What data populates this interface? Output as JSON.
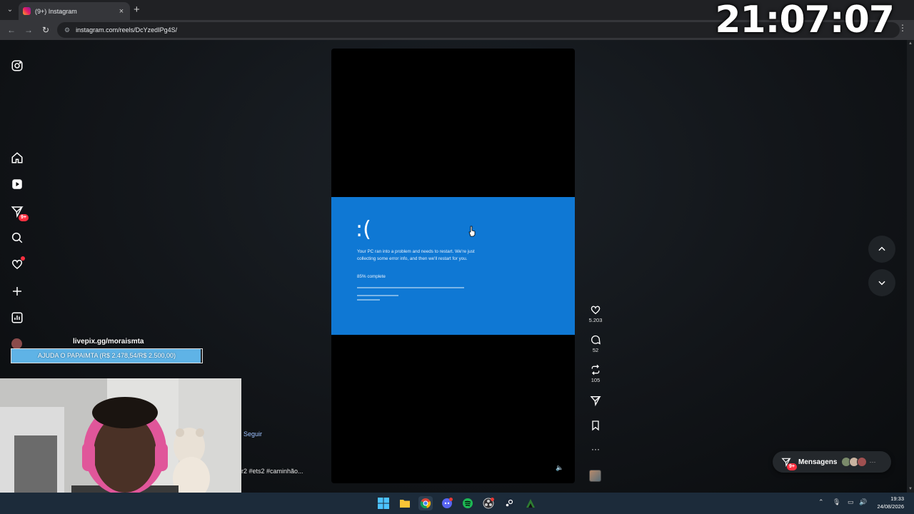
{
  "browser": {
    "tab_title": "(9+) Instagram",
    "url": "instagram.com/reels/DcYzedIPg4S/"
  },
  "overlay": {
    "clock": "21:07:07",
    "livepix_label": "livepix.gg/moraismta",
    "goal_text": "AJUDA O PAPAIMTA (R$ 2.478,54/R$ 2.500,00)",
    "goal_progress": 0.991
  },
  "sidebar": {
    "items": [
      {
        "name": "instagram-logo-icon"
      },
      {
        "name": "home-icon"
      },
      {
        "name": "reels-icon"
      },
      {
        "name": "messages-icon",
        "badge": "9+"
      },
      {
        "name": "search-icon"
      },
      {
        "name": "notifications-icon"
      },
      {
        "name": "create-icon"
      },
      {
        "name": "dashboard-icon"
      }
    ]
  },
  "reel": {
    "bsod_face": ":(",
    "bsod_message": "Your PC ran into a problem and needs to restart. We're just collecting some error info, and then we'll restart for you.",
    "bsod_progress": "85% complete",
    "colors": {
      "bsod": "#0f78d4"
    }
  },
  "actions": {
    "likes": "5.203",
    "comments": "52",
    "reposts": "105"
  },
  "post": {
    "follow_label": "Seguir",
    "caption": "r2 #ets2 #caminhão..."
  },
  "messages": {
    "label": "Mensagens",
    "badge": "9+"
  },
  "taskbar": {
    "time": "19:33",
    "date": "24/08/2026"
  }
}
